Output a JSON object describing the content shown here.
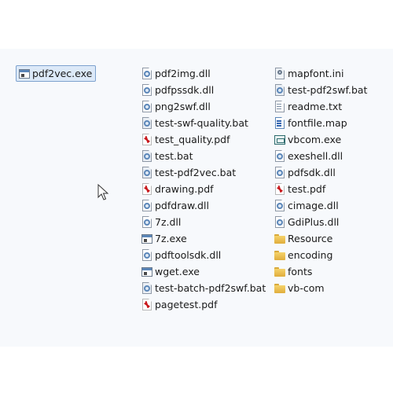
{
  "selected": {
    "label": "pdf2vec.exe",
    "icon": "exe-window-icon"
  },
  "column1": [
    {
      "label": "pdf2img.dll",
      "icon": "dll-gear-icon"
    },
    {
      "label": "pdfpssdk.dll",
      "icon": "dll-gear-icon"
    },
    {
      "label": "png2swf.dll",
      "icon": "dll-gear-icon"
    },
    {
      "label": "test-swf-quality.bat",
      "icon": "bat-gear-icon"
    },
    {
      "label": "test_quality.pdf",
      "icon": "pdf-icon"
    },
    {
      "label": "test.bat",
      "icon": "bat-gear-icon"
    },
    {
      "label": "test-pdf2vec.bat",
      "icon": "bat-gear-icon"
    },
    {
      "label": "drawing.pdf",
      "icon": "pdf-icon"
    },
    {
      "label": "pdfdraw.dll",
      "icon": "dll-gear-icon"
    },
    {
      "label": "7z.dll",
      "icon": "dll-gear-icon"
    },
    {
      "label": "7z.exe",
      "icon": "exe-window-icon"
    },
    {
      "label": "pdftoolsdk.dll",
      "icon": "dll-gear-icon"
    },
    {
      "label": "wget.exe",
      "icon": "exe-window-icon"
    },
    {
      "label": "test-batch-pdf2swf.bat",
      "icon": "bat-gear-icon"
    },
    {
      "label": "pagetest.pdf",
      "icon": "pdf-icon"
    }
  ],
  "column2": [
    {
      "label": "mapfont.ini",
      "icon": "ini-icon"
    },
    {
      "label": "test-pdf2swf.bat",
      "icon": "bat-gear-icon"
    },
    {
      "label": "readme.txt",
      "icon": "text-file-icon"
    },
    {
      "label": "fontfile.map",
      "icon": "map-file-icon"
    },
    {
      "label": "vbcom.exe",
      "icon": "vb-exe-icon"
    },
    {
      "label": "exeshell.dll",
      "icon": "dll-gear-icon"
    },
    {
      "label": "pdfsdk.dll",
      "icon": "dll-gear-icon"
    },
    {
      "label": "test.pdf",
      "icon": "pdf-icon"
    },
    {
      "label": "cimage.dll",
      "icon": "dll-gear-icon"
    },
    {
      "label": "GdiPlus.dll",
      "icon": "dll-gear-icon"
    },
    {
      "label": "Resource",
      "icon": "folder-icon"
    },
    {
      "label": "encoding",
      "icon": "folder-icon"
    },
    {
      "label": "fonts",
      "icon": "folder-icon"
    },
    {
      "label": "vb-com",
      "icon": "folder-icon"
    }
  ]
}
